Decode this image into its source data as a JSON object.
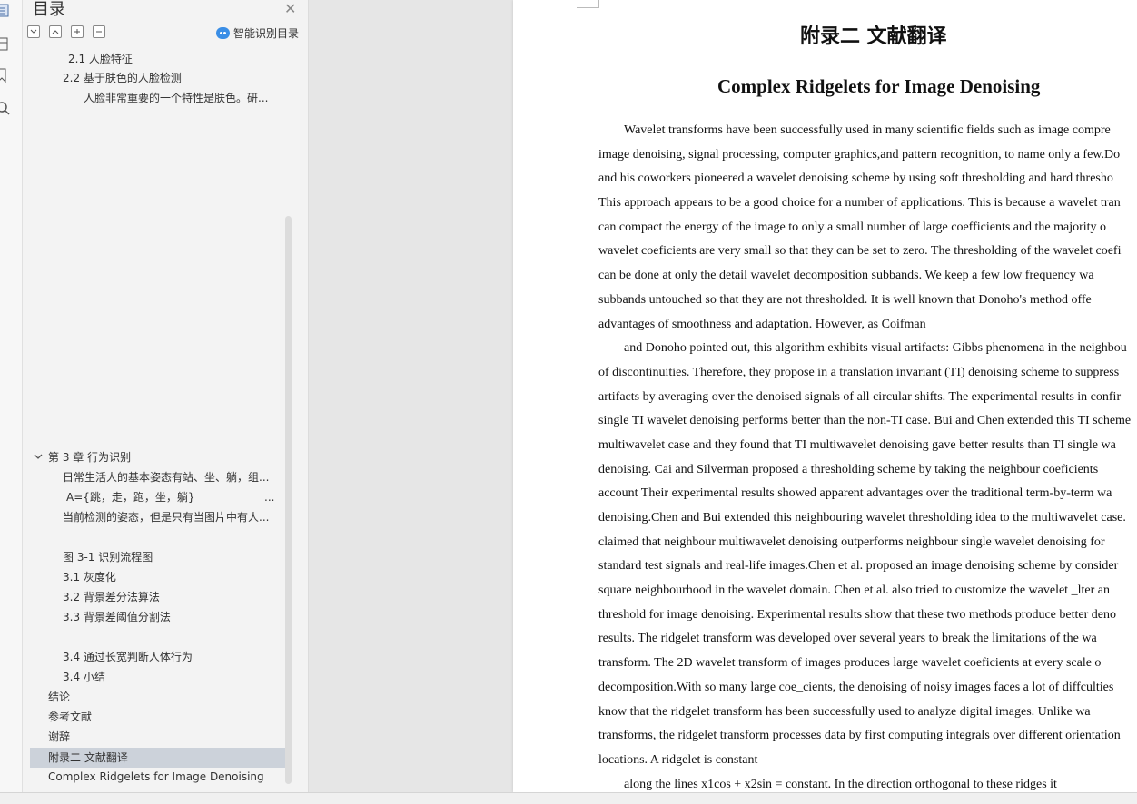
{
  "nav": {
    "title": "目录",
    "smart_toc_label": "智能识别目录",
    "items": [
      {
        "text": "2.1 人脸特征"
      },
      {
        "text": "2.2  基于肤色的人脸检测"
      },
      {
        "text": "人脸非常重要的一个特性是肤色。研..."
      },
      {
        "text": "第 3 章  行为识别"
      },
      {
        "text": "日常生活人的基本姿态有站、坐、躺，组..."
      },
      {
        "text": "A={跳，走，跑，坐，躺}"
      },
      {
        "text": "当前检测的姿态，但是只有当图片中有人..."
      },
      {
        "text": "图 3-1  识别流程图"
      },
      {
        "text": "3.1  灰度化"
      },
      {
        "text": "3.2 背景差分法算法"
      },
      {
        "text": "3.3 背景差阈值分割法"
      },
      {
        "text": "3.4 通过长宽判断人体行为"
      },
      {
        "text": "3.4 小结"
      },
      {
        "text": "结论"
      },
      {
        "text": "参考文献"
      },
      {
        "text": "谢辞"
      },
      {
        "text": "附录二  文献翻译"
      },
      {
        "text": "Complex Ridgelets for Image Denoising"
      }
    ],
    "ellipsis": "..."
  },
  "document": {
    "heading": "附录二  文献翻译",
    "title": "Complex Ridgelets for Image Denoising",
    "lines": [
      "Wavelet transforms have been successfully used in many scientific fields such as image compre",
      "image denoising, signal processing, computer graphics,and pattern recognition, to name only a few.Do",
      "and his coworkers pioneered a wavelet denoising scheme by using soft thresholding and hard thresho",
      "This approach appears to be a good choice for a number of applications. This is because a wavelet tran",
      "can compact the energy of the image to only a small number of large coefficients and the majority o",
      "wavelet coeficients are very small so that they can be set to zero. The thresholding of the wavelet coefi",
      "can be done at only the detail wavelet decomposition subbands. We keep a few low frequency wa",
      "subbands untouched so that they are not thresholded. It is well known that Donoho's method offe",
      "advantages of smoothness and adaptation. However, as Coifman",
      "and Donoho pointed out, this algorithm exhibits visual artifacts: Gibbs phenomena in the neighbou",
      "of discontinuities. Therefore, they propose in a translation invariant (TI) denoising scheme to suppress",
      "artifacts by averaging over the denoised signals of all circular shifts. The experimental results in confir",
      "single TI wavelet denoising performs better than the non-TI case. Bui and Chen extended this TI scheme",
      "multiwavelet case and they found that TI multiwavelet denoising gave better results than TI single wa",
      "denoising. Cai and Silverman  proposed a thresholding scheme by taking the neighbour coeficients",
      "account Their experimental results showed apparent advantages over the traditional term-by-term wa",
      "denoising.Chen and Bui extended this neighbouring wavelet thresholding idea to the multiwavelet case.",
      "claimed that neighbour multiwavelet denoising outperforms neighbour single wavelet denoising for",
      "standard test signals and real-life images.Chen et al. proposed an image denoising scheme by consider",
      "square neighbourhood in the wavelet domain. Chen et al. also tried to customize the wavelet _lter an",
      "threshold for image denoising. Experimental results show that these two methods produce better deno",
      "results. The ridgelet transform was developed over several years to break the limitations of the wa",
      "transform. The 2D wavelet transform of images produces large wavelet coeficients at every scale o",
      "decomposition.With so many large coe_cients, the denoising of noisy images faces a lot of diffculties",
      "know that the ridgelet transform has been successfully used to analyze digital images. Unlike wa",
      "transforms, the ridgelet transform processes data by first computing integrals over different orientation",
      "locations. A ridgelet is constant",
      "along the lines x1cos  + x2sin  = constant. In the direction orthogonal to these ridges it"
    ]
  },
  "icons": [
    "toc-icon",
    "page-icon",
    "bookmark-icon",
    "search-icon",
    "close-icon",
    "collapse-all-icon",
    "expand-up-icon",
    "add-icon",
    "remove-icon",
    "smart-robot-icon",
    "chevron-down-icon"
  ]
}
